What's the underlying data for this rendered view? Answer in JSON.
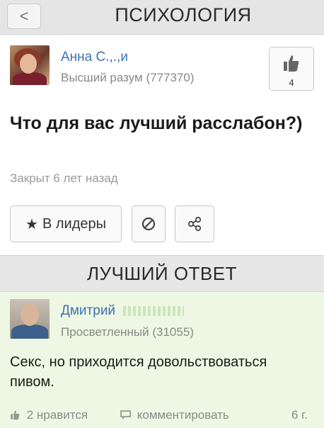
{
  "header": {
    "back_glyph": "<",
    "section_title": "ПСИХОЛОГИЯ"
  },
  "question": {
    "author_name": "Анна С.,.,и",
    "author_rank": "Высший разум (777370)",
    "likes": "4",
    "title": "Что для вас лучший расслабон?)",
    "status": "Закрыт 6 лет назад",
    "leaders_button": "В лидеры",
    "icons": {
      "leaders": "star-icon",
      "block": "block-icon",
      "share": "share-icon",
      "like": "thumbs-up-icon"
    }
  },
  "best_answer": {
    "section_title": "ЛУЧШИЙ ОТВЕТ",
    "author_name": "Дмитрий",
    "author_rank": "Просветленный (31055)",
    "text": "Секс, но приходится довольствоваться пивом.",
    "likes_label": "2 нравится",
    "comment_label": "комментировать",
    "age": "6 г."
  },
  "colors": {
    "link": "#3c73b3",
    "answer_bg": "#eef7e3",
    "header_bg": "#e5e5e5"
  }
}
